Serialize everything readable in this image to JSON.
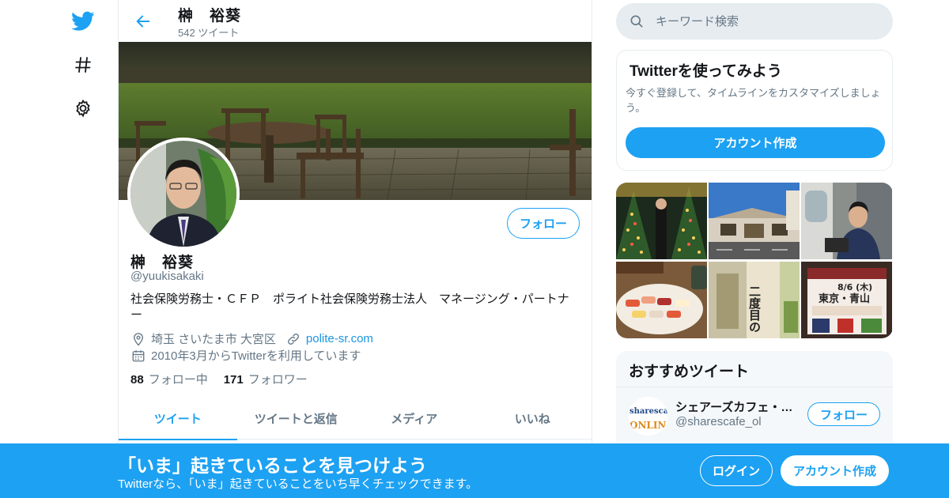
{
  "nav": {
    "logo_icon": "twitter-bird-icon",
    "explore_icon": "hashtag-icon",
    "settings_icon": "gear-icon"
  },
  "header": {
    "name": "榊　裕葵",
    "tweet_count": "542 ツイート"
  },
  "profile": {
    "name": "榊　裕葵",
    "handle": "@yuukisakaki",
    "bio": "社会保険労務士・ＣＦＰ　ポライト社会保険労務士法人　マネージング・パートナー",
    "location": "埼玉 さいたま市 大宮区",
    "website": "polite-sr.com",
    "joined": "2010年3月からTwitterを利用しています",
    "following_count": "88",
    "following_label": "フォロー中",
    "followers_count": "171",
    "followers_label": "フォロワー",
    "follow_button": "フォロー"
  },
  "tabs": [
    {
      "label": "ツイート",
      "active": true
    },
    {
      "label": "ツイートと返信",
      "active": false
    },
    {
      "label": "メディア",
      "active": false
    },
    {
      "label": "いいね",
      "active": false
    }
  ],
  "search": {
    "placeholder": "キーワード検索"
  },
  "signup_card": {
    "title": "Twitterを使ってみよう",
    "description": "今すぐ登録して、タイムラインをカスタマイズしましょう。",
    "button": "アカウント作成"
  },
  "recommended": {
    "title": "おすすめツイート",
    "account_name": "シェアーズカフェ・オンライン",
    "account_handle": "@sharescafe_ol",
    "avatar_text_top": "sharescafe",
    "avatar_text_bottom": "ONLINE",
    "follow_button": "フォロー"
  },
  "photos": {
    "event_text_date": "8/6 (木)",
    "event_text_place": "東京・青山",
    "book_title": "二度目の"
  },
  "bottom_bar": {
    "title": "「いま」起きていることを見つけよう",
    "subtitle": "Twitterなら、「いま」起きていることをいち早くチェックできます。",
    "login": "ログイン",
    "signup": "アカウント作成"
  },
  "colors": {
    "brand": "#1da1f2",
    "link": "#1b95e0",
    "secondary_text": "#657786",
    "border": "#e6ecf0"
  }
}
